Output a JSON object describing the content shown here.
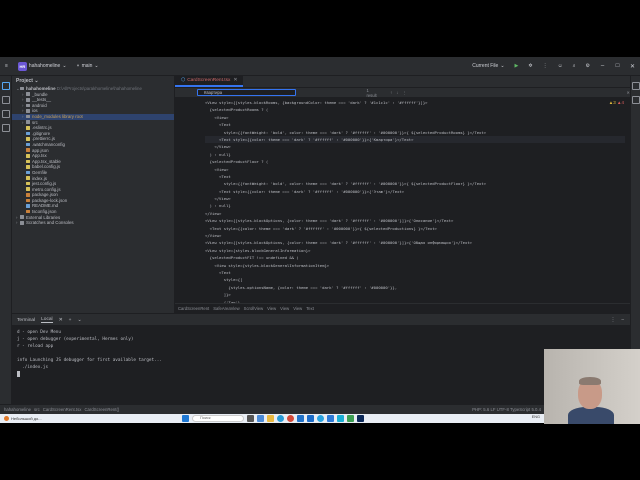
{
  "titlebar": {
    "project_badge": "HR",
    "project_name": "hahahomeline",
    "branch": "main",
    "run_config": "Current File",
    "accent": "#6b57d6"
  },
  "project_panel": {
    "title": "Project",
    "root": "hahahomeline",
    "root_path": "D:\\AllProjects\\parakhomeline\\hahahomeline",
    "items": [
      {
        "label": "_bundle",
        "type": "folder"
      },
      {
        "label": "__tests__",
        "type": "folder"
      },
      {
        "label": "android",
        "type": "folder"
      },
      {
        "label": "ios",
        "type": "folder"
      },
      {
        "label": "node_modules  library root",
        "type": "folder",
        "selected": true
      },
      {
        "label": "src",
        "type": "folder"
      },
      {
        "label": ".eslintrc.js",
        "type": "js"
      },
      {
        "label": ".gitignore",
        "type": "cfg"
      },
      {
        "label": ".prettierrc.js",
        "type": "js"
      },
      {
        "label": ".watchmanconfig",
        "type": "cfg"
      },
      {
        "label": "app.json",
        "type": "json"
      },
      {
        "label": "App.tsx",
        "type": "js"
      },
      {
        "label": "App.tsx_stable",
        "type": "js"
      },
      {
        "label": "babel.config.js",
        "type": "js"
      },
      {
        "label": "Gemfile",
        "type": "cfg"
      },
      {
        "label": "index.js",
        "type": "js"
      },
      {
        "label": "jest.config.js",
        "type": "js"
      },
      {
        "label": "metro.config.js",
        "type": "js"
      },
      {
        "label": "package.json",
        "type": "json"
      },
      {
        "label": "package-lock.json",
        "type": "json"
      },
      {
        "label": "README.md",
        "type": "cfg"
      },
      {
        "label": "tsconfig.json",
        "type": "json"
      },
      {
        "label": "External Libraries",
        "type": "folder"
      },
      {
        "label": "Scratches and Consoles",
        "type": "folder"
      }
    ]
  },
  "editor": {
    "tab": "CardScreenRent.tsx",
    "search_value": "Квартира",
    "search_results": "1 result",
    "warnings": "3",
    "errors": "4",
    "line_numbers": [
      "",
      "",
      "",
      "",
      "",
      "",
      "",
      "",
      "",
      "",
      "",
      "",
      "",
      "",
      "",
      "",
      "",
      "",
      "",
      "",
      "",
      "",
      "",
      "",
      "",
      "",
      "",
      ""
    ],
    "lines": [
      "<View style={[styles.blockRooms, {backgroundColor: theme === 'dark' ? '#1c1c1c' : '#ffffff'}]}>",
      "  {selectedProductRooms ? (",
      "    <View>",
      "      <Text",
      "        style={{fontWeight: 'bold', color: theme === 'dark' ? '#ffffff' : '#000000'}}>{ ${selectedProductRooms} }</Text>",
      "      <Text style={{color: theme === 'dark' ? '#ffffff' : '#000000'}}>{'Квартира'}</Text>",
      "    </View>",
      "  ) : null}",
      "  {selectedProductFloor ? (",
      "    <View>",
      "      <Text",
      "        style={{fontWeight: 'bold', color: theme === 'dark' ? '#ffffff' : '#000000'}}>{ ${selectedProductFloor} }</Text>",
      "      <Text style={{color: theme === 'dark' ? '#ffffff' : '#000000'}}>{'Этаж'}</Text>",
      "    </View>",
      "  ) : null}",
      "</View>",
      "<View style={[styles.blockOptions, {color: theme === 'dark' ? '#ffffff' : '#000000'}]}>{'Описание'}</Text>",
      "  <Text style={{color: theme === 'dark' ? '#ffffff' : '#000000'}}>{ ${selectedProductions} }</Text>",
      "</View>",
      "<View style={[styles.blockOptions, {color: theme === 'dark' ? '#ffffff' : '#000000'}]}>{'Общая информация'}</Text>",
      "<View style={styles.blockGeneralInformation}>",
      "  {selectedProductFIT !== undefined && (",
      "    <View style={styles.blockGeneralInformationItem}>",
      "      <Text",
      "        style={[",
      "          {styles.optionsName, {color: theme === 'dark' ? '#ffffff' : '#000000'}},",
      "        ]}>",
      "        {'Тип'}"
    ],
    "highlight_line": 5,
    "breadcrumb": [
      "CardScreenRent",
      "SafeAreaView",
      "ScrollView",
      "View",
      "View",
      "View",
      "Text"
    ]
  },
  "terminal": {
    "tab_title": "Terminal",
    "tab_local": "Local",
    "lines": [
      "d - open Dev Menu",
      "j - open debugger (experimental, Hermes only)",
      "r - reload app",
      "",
      "info Launching JS debugger for first available target...",
      "  ./index.js"
    ],
    "info_tag": "info",
    "js_tag": "JS"
  },
  "statusbar": {
    "path": [
      "hahahomeline",
      "src",
      "CardScreenRent.tsx",
      "CardScreenRent()"
    ],
    "right": "PHP: 5.6   LF   UTF-8   TypeScript 5.0.4"
  },
  "taskbar": {
    "weather": "Небольшой до...",
    "weather_sub": "",
    "search_placeholder": "Поиск",
    "lang": "ENG"
  }
}
